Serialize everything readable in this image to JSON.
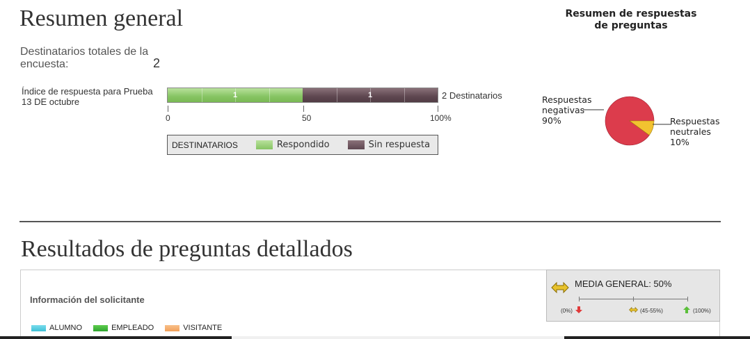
{
  "summary": {
    "title": "Resumen general",
    "total_recipients_label": "Destinatarios totales de la encuesta:",
    "total_recipients_value": "2",
    "response_rate_label": "Índice de respuesta para Prueba 13 DE octubre",
    "bar": {
      "segments": [
        {
          "label": "1",
          "value": 1,
          "color": "#86c463"
        },
        {
          "label": "1",
          "value": 1,
          "color": "#5e4750"
        }
      ],
      "right_label": "2 Destinatarios",
      "ticks": [
        "0",
        "50",
        "100%"
      ]
    },
    "legend": {
      "title": "DESTINATARIOS",
      "items": [
        {
          "label": "Respondido",
          "color": "#8fca6c"
        },
        {
          "label": "Sin respuesta",
          "color": "#6b5660"
        }
      ]
    }
  },
  "pie": {
    "title_line1": "Resumen de respuestas",
    "title_line2": "de preguntas",
    "labels": {
      "negative_line1": "Respuestas",
      "negative_line2": "negativas",
      "negative_pct": "90%",
      "neutral_line1": "Respuestas",
      "neutral_line2": "neutrales",
      "neutral_pct": "10%"
    },
    "slices": [
      {
        "name": "negativas",
        "value": 90,
        "color": "#dc3c4c"
      },
      {
        "name": "neutrales",
        "value": 10,
        "color": "#f2c230"
      }
    ]
  },
  "details": {
    "title": "Resultados de preguntas detallados",
    "section_label": "Información del solicitante",
    "categories": [
      {
        "label": "ALUMNO",
        "color": "#3ec0d6"
      },
      {
        "label": "EMPLEADO",
        "color": "#2fa52f"
      },
      {
        "label": "VISITANTE",
        "color": "#f2a05a"
      }
    ],
    "media": {
      "label": "MEDIA GENERAL: 50%",
      "value_pct": 50,
      "scale_labels": [
        "(0%)",
        "(45-55%)",
        "(100%)"
      ]
    }
  }
}
